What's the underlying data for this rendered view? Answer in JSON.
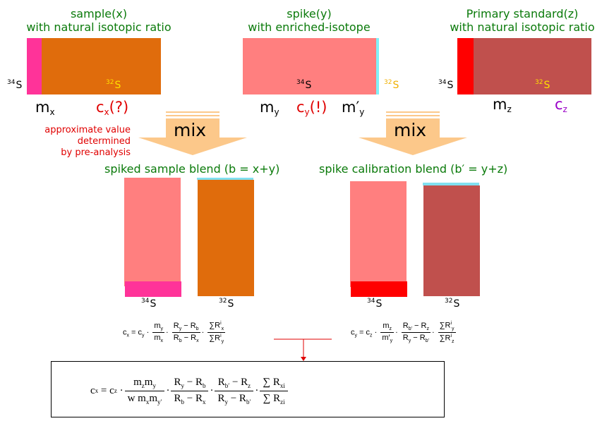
{
  "colors": {
    "title_green": "#0a7a0a",
    "s34_sample": "#ff3399",
    "s32_sample": "#e06c0c",
    "spike_34": "#ff7f7f",
    "spike_32": "#80f0f8",
    "standard_34": "#ff0000",
    "standard_32": "#c0504d",
    "mix_arrow": "#fcc88a",
    "annotation_red": "#e00000",
    "cz_purple": "#9a00c8"
  },
  "sample": {
    "title_line1": "sample(x)",
    "title_line2": "with natural isotopic ratio",
    "isotope_34": "34",
    "isotope_32": "32",
    "element": "S",
    "mass_label": "m",
    "mass_sub": "x",
    "conc_label": "c",
    "conc_sub": "x",
    "conc_suffix": "(?)",
    "note_line1": "approximate value",
    "note_line2": "determined",
    "note_line3": "by pre-analysis"
  },
  "spike": {
    "title_line1": "spike(y)",
    "title_line2": "with enriched-isotope",
    "isotope_34": "34",
    "isotope_32": "32",
    "element": "S",
    "mass_label": "m",
    "mass_sub": "y",
    "conc_label": "c",
    "conc_sub": "y",
    "conc_suffix": "(!)",
    "mass2_label": "m′",
    "mass2_sub": "y"
  },
  "standard": {
    "title_line1": "Primary standard(z)",
    "title_line2": "with natural isotopic ratio",
    "isotope_34": "34",
    "isotope_32": "32",
    "element": "S",
    "mass_label": "m",
    "mass_sub": "z",
    "conc_label": "c",
    "conc_sub": "z"
  },
  "mix_left": {
    "label": "mix"
  },
  "mix_right": {
    "label": "mix"
  },
  "blend_sample": {
    "title": "spiked sample blend (b = x+y)",
    "isotope_34": "34",
    "isotope_32": "32",
    "element": "S"
  },
  "blend_calibration": {
    "title": "spike calibration blend (b′ = y+z)",
    "isotope_34": "34",
    "isotope_32": "32",
    "element": "S"
  },
  "equation_x": {
    "lhs": "c",
    "lhs_sub": "x",
    "c": "c",
    "c_sub": "y",
    "f1_num": "m",
    "f1_num_sub": "y",
    "f1_den": "m",
    "f1_den_sub": "x",
    "f2_num": "R",
    "f2_num_sub1": "y",
    "f2_num_mid": " − R",
    "f2_num_sub2": "b",
    "f2_den": "R",
    "f2_den_sub1": "b",
    "f2_den_mid": " − R",
    "f2_den_sub2": "x",
    "f3_num": "∑R",
    "f3_num_sub": "x",
    "f3_num_sup": "i",
    "f3_den": "∑R",
    "f3_den_sub": "y",
    "f3_den_sup": "i"
  },
  "equation_y": {
    "lhs": "c",
    "lhs_sub": "y",
    "c": "c",
    "c_sub": "z",
    "f1_num": "m",
    "f1_num_sub": "z",
    "f1_den": "m′",
    "f1_den_sub": "y",
    "f2_num": "R",
    "f2_num_sub1": "b′",
    "f2_num_mid": " − R",
    "f2_num_sub2": "z",
    "f2_den": "R",
    "f2_den_sub1": "y",
    "f2_den_mid": " − R",
    "f2_den_sub2": "b′",
    "f3_num": "∑R",
    "f3_num_sub": "y",
    "f3_num_sup": "i",
    "f3_den": "∑R",
    "f3_den_sub": "z",
    "f3_den_sup": "i"
  },
  "final_equation": {
    "lhs": "c",
    "lhs_sub": "x",
    "eq": "=",
    "c": "c",
    "c_sub": "z",
    "f1_num_a": "m",
    "f1_num_a_sub": "z",
    "f1_num_b": "m",
    "f1_num_b_sub": "y",
    "f1_den_w": "w",
    "f1_den_a": "m",
    "f1_den_a_sub": "x",
    "f1_den_b": "m",
    "f1_den_b_sub": "y′",
    "f2_num": "R",
    "f2_num_sub1": "y",
    "f2_num_mid": " − R",
    "f2_num_sub2": "b",
    "f2_den": "R",
    "f2_den_sub1": "b",
    "f2_den_mid": " − R",
    "f2_den_sub2": "x",
    "f3_num": "R",
    "f3_num_sub1": "b′",
    "f3_num_mid": " − R",
    "f3_num_sub2": "z",
    "f3_den": "R",
    "f3_den_sub1": "y",
    "f3_den_mid": " − R",
    "f3_den_sub2": "b′",
    "f4_num": "∑ R",
    "f4_num_sub": "xi",
    "f4_idx": "i",
    "f4_den": "∑ R",
    "f4_den_sub": "zi"
  }
}
